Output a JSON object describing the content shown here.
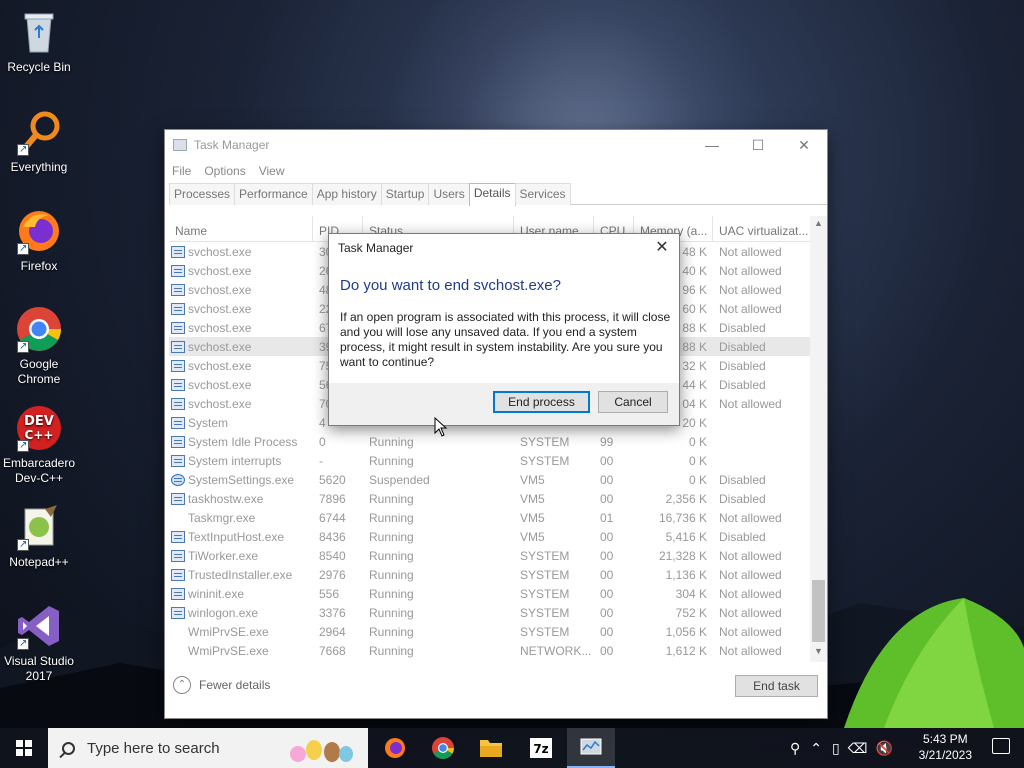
{
  "desktop": {
    "icons": [
      {
        "label": "Recycle Bin",
        "icon": "recycle-bin-icon"
      },
      {
        "label": "Everything",
        "icon": "everything-search-icon"
      },
      {
        "label": "Firefox",
        "icon": "firefox-icon"
      },
      {
        "label": "Google Chrome",
        "icon": "chrome-icon"
      },
      {
        "label": "Embarcadero Dev-C++",
        "icon": "devcpp-icon"
      },
      {
        "label": "Notepad++",
        "icon": "notepadpp-icon"
      },
      {
        "label": "Visual Studio 2017",
        "icon": "visual-studio-icon"
      }
    ]
  },
  "task_manager": {
    "title": "Task Manager",
    "menu": [
      "File",
      "Options",
      "View"
    ],
    "tabs": [
      "Processes",
      "Performance",
      "App history",
      "Startup",
      "Users",
      "Details",
      "Services"
    ],
    "active_tab": "Details",
    "columns": [
      "Name",
      "PID",
      "Status",
      "User name",
      "CPU",
      "Memory (a...",
      "UAC virtualizat..."
    ],
    "rows": [
      {
        "name": "svchost.exe",
        "pid": "30",
        "status": "",
        "user": "",
        "cpu": "",
        "mem": "48 K",
        "uac": "Not allowed",
        "icon": "generic"
      },
      {
        "name": "svchost.exe",
        "pid": "26",
        "status": "",
        "user": "",
        "cpu": "",
        "mem": "40 K",
        "uac": "Not allowed",
        "icon": "generic"
      },
      {
        "name": "svchost.exe",
        "pid": "48",
        "status": "",
        "user": "",
        "cpu": "",
        "mem": "96 K",
        "uac": "Not allowed",
        "icon": "generic"
      },
      {
        "name": "svchost.exe",
        "pid": "22",
        "status": "",
        "user": "",
        "cpu": "",
        "mem": "60 K",
        "uac": "Not allowed",
        "icon": "generic"
      },
      {
        "name": "svchost.exe",
        "pid": "67",
        "status": "",
        "user": "",
        "cpu": "",
        "mem": "88 K",
        "uac": "Disabled",
        "icon": "generic"
      },
      {
        "name": "svchost.exe",
        "pid": "39",
        "status": "",
        "user": "",
        "cpu": "",
        "mem": "88 K",
        "uac": "Disabled",
        "icon": "generic",
        "selected": true
      },
      {
        "name": "svchost.exe",
        "pid": "75",
        "status": "",
        "user": "",
        "cpu": "",
        "mem": "32 K",
        "uac": "Disabled",
        "icon": "generic"
      },
      {
        "name": "svchost.exe",
        "pid": "56",
        "status": "",
        "user": "",
        "cpu": "",
        "mem": "44 K",
        "uac": "Disabled",
        "icon": "generic"
      },
      {
        "name": "svchost.exe",
        "pid": "70",
        "status": "",
        "user": "",
        "cpu": "",
        "mem": "04 K",
        "uac": "Not allowed",
        "icon": "generic"
      },
      {
        "name": "System",
        "pid": "4",
        "status": "",
        "user": "",
        "cpu": "",
        "mem": "20 K",
        "uac": "",
        "icon": "generic"
      },
      {
        "name": "System Idle Process",
        "pid": "0",
        "status": "Running",
        "user": "SYSTEM",
        "cpu": "99",
        "mem": "0 K",
        "uac": "",
        "icon": "generic"
      },
      {
        "name": "System interrupts",
        "pid": "-",
        "status": "Running",
        "user": "SYSTEM",
        "cpu": "00",
        "mem": "0 K",
        "uac": "",
        "icon": "generic"
      },
      {
        "name": "SystemSettings.exe",
        "pid": "5620",
        "status": "Suspended",
        "user": "VM5",
        "cpu": "00",
        "mem": "0 K",
        "uac": "Disabled",
        "icon": "gear"
      },
      {
        "name": "taskhostw.exe",
        "pid": "7896",
        "status": "Running",
        "user": "VM5",
        "cpu": "00",
        "mem": "2,356 K",
        "uac": "Disabled",
        "icon": "generic"
      },
      {
        "name": "Taskmgr.exe",
        "pid": "6744",
        "status": "Running",
        "user": "VM5",
        "cpu": "01",
        "mem": "16,736 K",
        "uac": "Not allowed",
        "icon": "tm"
      },
      {
        "name": "TextInputHost.exe",
        "pid": "8436",
        "status": "Running",
        "user": "VM5",
        "cpu": "00",
        "mem": "5,416 K",
        "uac": "Disabled",
        "icon": "generic"
      },
      {
        "name": "TiWorker.exe",
        "pid": "8540",
        "status": "Running",
        "user": "SYSTEM",
        "cpu": "00",
        "mem": "21,328 K",
        "uac": "Not allowed",
        "icon": "generic"
      },
      {
        "name": "TrustedInstaller.exe",
        "pid": "2976",
        "status": "Running",
        "user": "SYSTEM",
        "cpu": "00",
        "mem": "1,136 K",
        "uac": "Not allowed",
        "icon": "generic"
      },
      {
        "name": "wininit.exe",
        "pid": "556",
        "status": "Running",
        "user": "SYSTEM",
        "cpu": "00",
        "mem": "304 K",
        "uac": "Not allowed",
        "icon": "generic"
      },
      {
        "name": "winlogon.exe",
        "pid": "3376",
        "status": "Running",
        "user": "SYSTEM",
        "cpu": "00",
        "mem": "752 K",
        "uac": "Not allowed",
        "icon": "generic"
      },
      {
        "name": "WmiPrvSE.exe",
        "pid": "2964",
        "status": "Running",
        "user": "SYSTEM",
        "cpu": "00",
        "mem": "1,056 K",
        "uac": "Not allowed",
        "icon": "tm"
      },
      {
        "name": "WmiPrvSE.exe",
        "pid": "7668",
        "status": "Running",
        "user": "NETWORK...",
        "cpu": "00",
        "mem": "1,612 K",
        "uac": "Not allowed",
        "icon": "tm"
      }
    ],
    "fewer_details": "Fewer details",
    "end_task": "End task"
  },
  "dialog": {
    "title": "Task Manager",
    "question": "Do you want to end svchost.exe?",
    "body": "If an open program is associated with this process, it will close and you will lose any unsaved data. If you end a system process, it might result in system instability. Are you sure you want to continue?",
    "primary_button": "End process",
    "cancel_button": "Cancel"
  },
  "taskbar": {
    "search_placeholder": "Type here to search",
    "pinned": [
      "firefox-icon",
      "chrome-icon",
      "file-explorer-icon",
      "7zip-icon",
      "task-manager-icon"
    ],
    "time": "5:43 PM",
    "date": "3/21/2023"
  }
}
